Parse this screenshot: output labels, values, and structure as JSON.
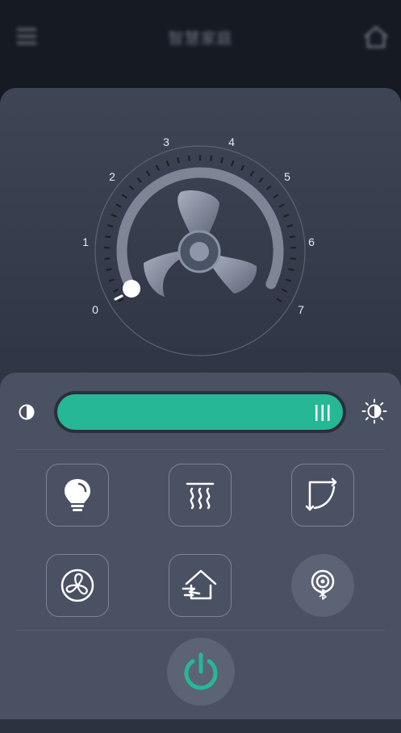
{
  "header": {
    "title": "智慧家庭",
    "menu_icon": "menu-icon",
    "home_icon": "home-icon"
  },
  "fan_dial": {
    "scale_labels": [
      "0",
      "1",
      "2",
      "3",
      "4",
      "5",
      "6",
      "7"
    ],
    "current_speed": 0,
    "center_icon": "fan-icon"
  },
  "brightness": {
    "level_percent": 100,
    "dim_icon": "brightness-low-icon",
    "bright_icon": "brightness-high-icon",
    "fill_color": "#26b896"
  },
  "buttons": [
    {
      "name": "light-button",
      "icon": "light-bulb-icon"
    },
    {
      "name": "heater-button",
      "icon": "heat-waves-icon"
    },
    {
      "name": "swing-button",
      "icon": "swing-arrows-icon"
    },
    {
      "name": "fan-button",
      "icon": "fan-icon"
    },
    {
      "name": "ventilation-button",
      "icon": "house-airflow-icon"
    },
    {
      "name": "bluetooth-button",
      "icon": "bluetooth-signal-icon"
    }
  ],
  "power": {
    "icon": "power-icon",
    "color": "#26b896"
  },
  "colors": {
    "accent": "#26b896",
    "panel": "#4a5162",
    "card": "#333a49",
    "background": "#161a22"
  }
}
